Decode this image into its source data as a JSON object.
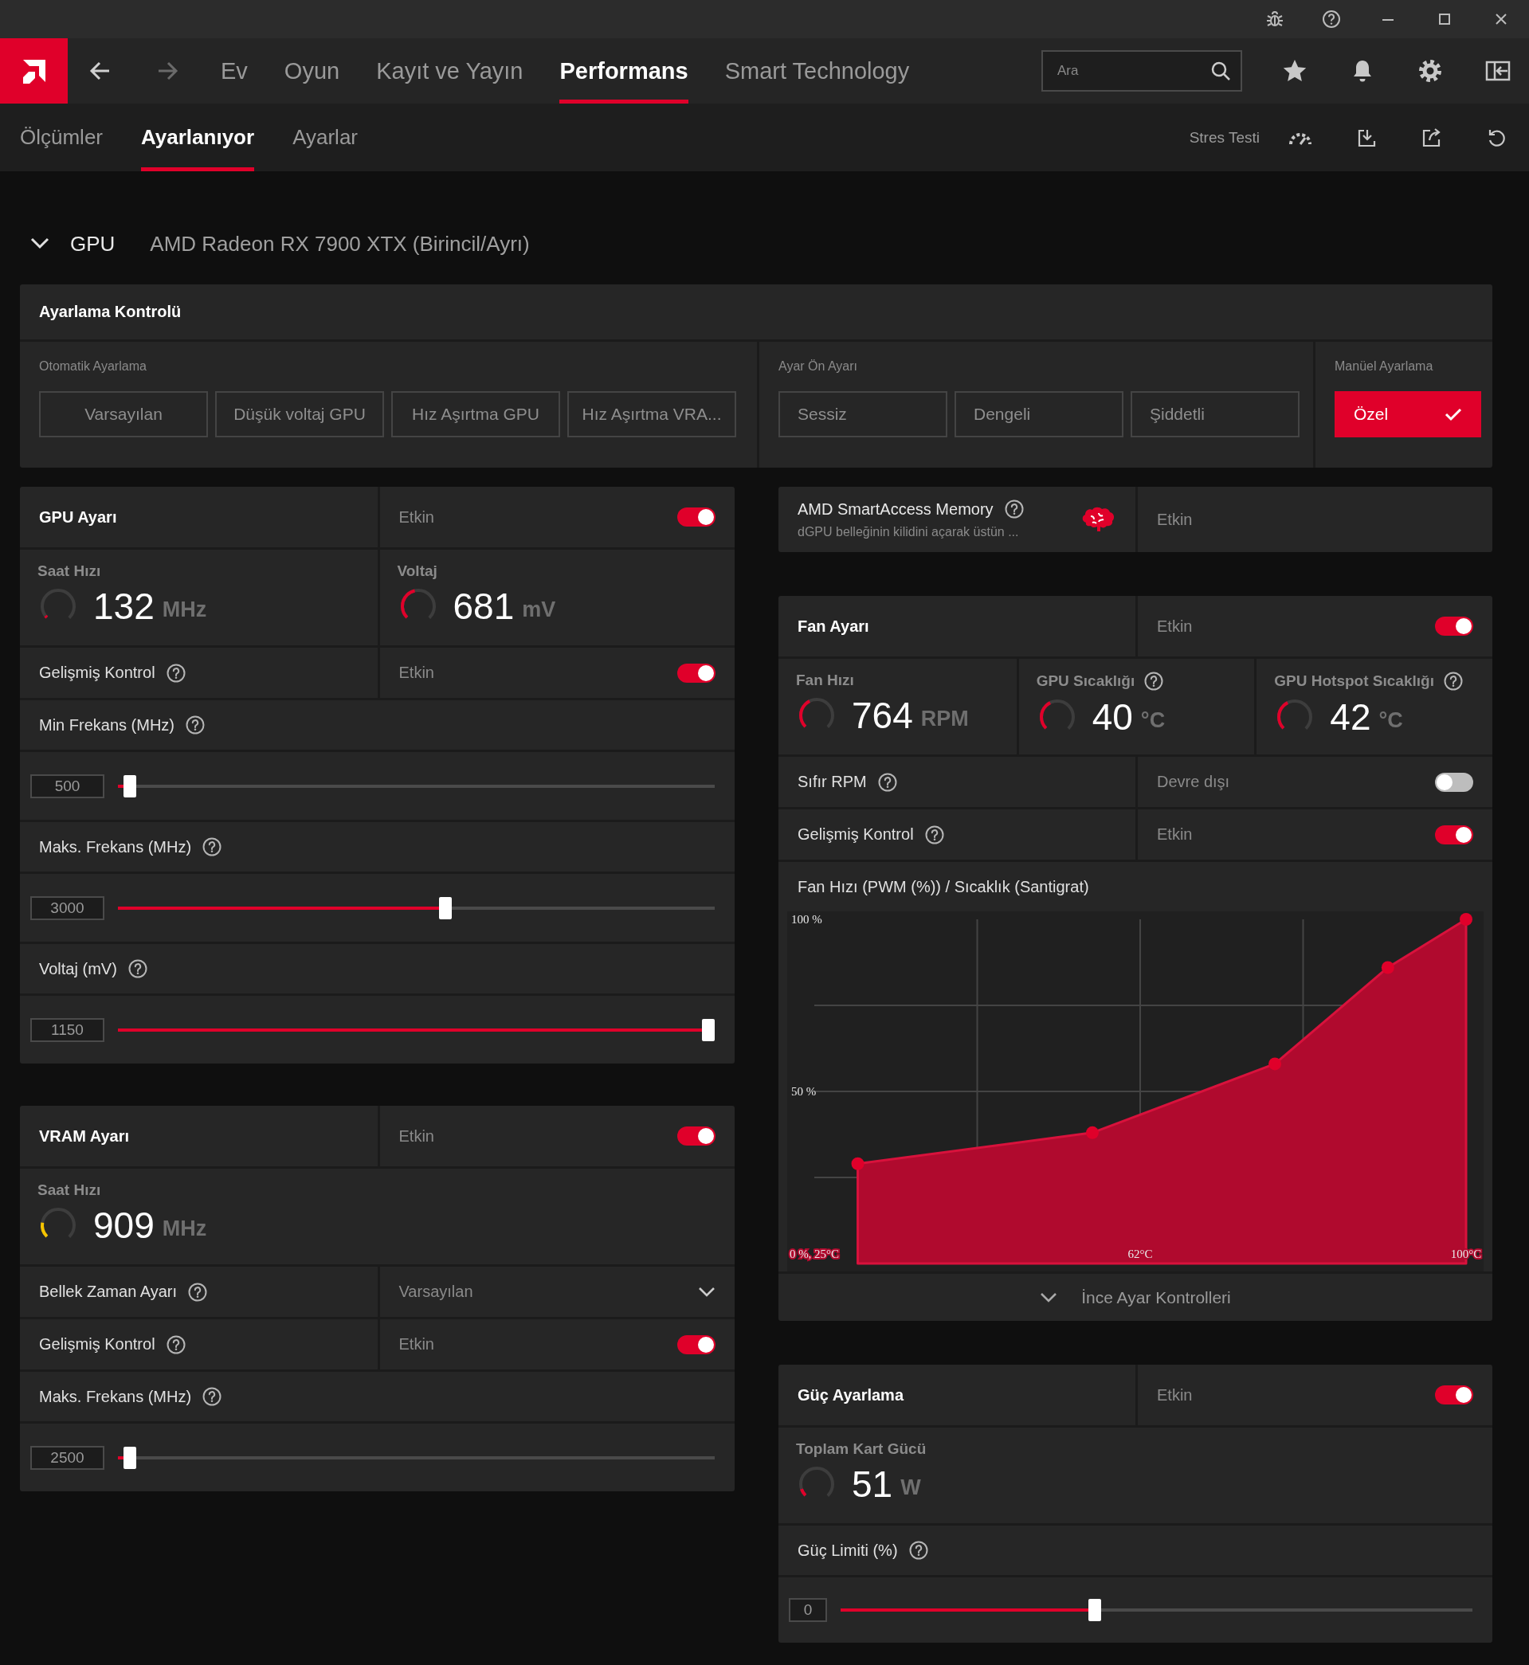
{
  "nav": {
    "back_disabled": false,
    "forward_disabled": true,
    "tabs": [
      {
        "label": "Ev",
        "selected": false
      },
      {
        "label": "Oyun",
        "selected": false
      },
      {
        "label": "Kayıt ve Yayın",
        "selected": false
      },
      {
        "label": "Performans",
        "selected": true
      },
      {
        "label": "Smart Technology",
        "selected": false
      }
    ],
    "search": {
      "placeholder": "Ara"
    }
  },
  "subnav": {
    "tabs": [
      {
        "label": "Ölçümler",
        "selected": false
      },
      {
        "label": "Ayarlanıyor",
        "selected": true
      },
      {
        "label": "Ayarlar",
        "selected": false
      }
    ],
    "stress_test": "Stres Testi"
  },
  "gpu_header": {
    "label": "GPU",
    "device": "AMD Radeon RX 7900 XTX (Birincil/Ayrı)",
    "expanded": true
  },
  "tuning_control": {
    "title": "Ayarlama Kontrolü",
    "groups": [
      {
        "label": "Otomatik Ayarlama",
        "options": [
          {
            "label": "Varsayılan",
            "selected": false
          },
          {
            "label": "Düşük voltaj GPU",
            "selected": false
          },
          {
            "label": "Hız Aşırtma GPU",
            "selected": false
          },
          {
            "label": "Hız Aşırtma VRA...",
            "selected": false
          }
        ]
      },
      {
        "label": "Ayar Ön Ayarı",
        "options": [
          {
            "label": "Sessiz",
            "selected": false
          },
          {
            "label": "Dengeli",
            "selected": false
          },
          {
            "label": "Şiddetli",
            "selected": false
          }
        ]
      },
      {
        "label": "Manüel Ayarlama",
        "options": [
          {
            "label": "Özel",
            "selected": true
          }
        ]
      }
    ]
  },
  "gpu_tuning": {
    "title": "GPU Ayarı",
    "status": "Etkin",
    "on": true,
    "metrics": [
      {
        "label": "Saat Hızı",
        "help": false,
        "value": "132",
        "unit": "MHz",
        "level": 0.03,
        "color": "#e0002a"
      },
      {
        "label": "Voltaj",
        "help": false,
        "value": "681",
        "unit": "mV",
        "level": 0.45,
        "color": "#e0002a"
      }
    ],
    "rows": [
      {
        "kind": "toggle",
        "label": "Gelişmiş Kontrol",
        "help": true,
        "status": "Etkin",
        "on": true
      },
      {
        "kind": "slider",
        "label": "Min Frekans (MHz)",
        "help": true,
        "value": "500",
        "level": 0.01
      },
      {
        "kind": "slider",
        "label": "Maks. Frekans (MHz)",
        "help": true,
        "value": "3000",
        "level": 0.55
      },
      {
        "kind": "slider",
        "label": "Voltaj (mV)",
        "help": true,
        "value": "1150",
        "level": 1
      }
    ]
  },
  "vram_tuning": {
    "title": "VRAM Ayarı",
    "status": "Etkin",
    "on": true,
    "metrics": [
      {
        "label": "Saat Hızı",
        "help": false,
        "value": "909",
        "unit": "MHz",
        "level": 0.2,
        "color": "#f5c400"
      }
    ],
    "rows": [
      {
        "kind": "dropdown",
        "label": "Bellek Zaman Ayarı",
        "help": true,
        "value": "Varsayılan"
      },
      {
        "kind": "toggle",
        "label": "Gelişmiş Kontrol",
        "help": true,
        "status": "Etkin",
        "on": true
      },
      {
        "kind": "slider",
        "label": "Maks. Frekans (MHz)",
        "help": true,
        "value": "2500",
        "level": 0.01
      }
    ]
  },
  "smart_access_memory": {
    "title": "AMD SmartAccess Memory",
    "description": "dGPU belleğinin kilidini açarak üstün ...",
    "status": "Etkin"
  },
  "fan_tuning": {
    "title": "Fan Ayarı",
    "status": "Etkin",
    "on": true,
    "metrics": [
      {
        "label": "Fan Hızı",
        "help": false,
        "value": "764",
        "unit": "RPM",
        "level": 0.4,
        "color": "#e0002a"
      },
      {
        "label": "GPU Sıcaklığı",
        "help": true,
        "value": "40",
        "unit": "°C",
        "level": 0.4,
        "color": "#e0002a"
      },
      {
        "label": "GPU Hotspot Sıcaklığı",
        "help": true,
        "value": "42",
        "unit": "°C",
        "level": 0.4,
        "color": "#e0002a"
      }
    ],
    "rows": [
      {
        "kind": "toggle",
        "label": "Sıfır RPM",
        "help": true,
        "status": "Devre dışı",
        "on": false
      },
      {
        "kind": "toggle",
        "label": "Gelişmiş Kontrol",
        "help": true,
        "status": "Etkin",
        "on": true
      }
    ],
    "curve": {
      "title": "Fan Hızı (PWM (%)) / Sıcaklık (Santigrat)",
      "chart_data": {
        "type": "area",
        "x": [
          30,
          57,
          78,
          91,
          100
        ],
        "series": [
          {
            "color": "#b00a2e",
            "values": [
              29,
              38,
              58,
              86,
              100
            ]
          }
        ],
        "xlim": [
          25,
          100
        ],
        "ylim": [
          0,
          100
        ],
        "xticks": [
          {
            "value": 25,
            "label": "0 %, 25°C"
          },
          {
            "value": 62.5,
            "label": "62°C"
          },
          {
            "value": 100,
            "label": "100°C"
          }
        ],
        "yticks": [
          {
            "value": 50,
            "label": "50 %"
          },
          {
            "value": 100,
            "label": "100 %"
          }
        ]
      }
    },
    "fine_tune": "İnce Ayar Kontrolleri"
  },
  "power_tuning": {
    "title": "Güç Ayarlama",
    "status": "Etkin",
    "on": true,
    "metrics": [
      {
        "label": "Toplam Kart Gücü",
        "help": false,
        "value": "51",
        "unit": "W",
        "level": 0.1,
        "color": "#e0002a"
      }
    ],
    "rows": [
      {
        "kind": "slider",
        "label": "Güç Limiti (%)",
        "help": true,
        "value": "0",
        "level": 0.4
      }
    ]
  }
}
